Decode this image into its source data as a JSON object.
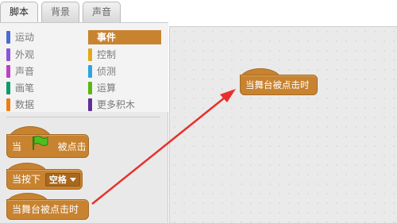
{
  "tabs": [
    {
      "label": "脚本",
      "active": true
    },
    {
      "label": "背景",
      "active": false
    },
    {
      "label": "声音",
      "active": false
    }
  ],
  "categories": [
    {
      "label": "运动",
      "color": "#4a6cd4",
      "active": false
    },
    {
      "label": "事件",
      "color": "#c88330",
      "active": true
    },
    {
      "label": "外观",
      "color": "#8a55d7",
      "active": false
    },
    {
      "label": "控制",
      "color": "#e1a91a",
      "active": false
    },
    {
      "label": "声音",
      "color": "#bb42c3",
      "active": false
    },
    {
      "label": "侦测",
      "color": "#2ca5e2",
      "active": false
    },
    {
      "label": "画笔",
      "color": "#0e9a6c",
      "active": false
    },
    {
      "label": "运算",
      "color": "#5cb712",
      "active": false
    },
    {
      "label": "数据",
      "color": "#ee7d16",
      "active": false
    },
    {
      "label": "更多积木",
      "color": "#632d99",
      "active": false
    }
  ],
  "blocks": {
    "flag_when": "当",
    "flag_icon": "green-flag-icon",
    "flag_clicked": "被点击",
    "key_pressed": "当按下",
    "key_value": "空格",
    "stage_clicked": "当舞台被点击时"
  },
  "script_area": {
    "block_label": "当舞台被点击时"
  },
  "annotation": {
    "arrow_color": "#e8302b"
  },
  "colors": {
    "event_block": "#c88330"
  }
}
